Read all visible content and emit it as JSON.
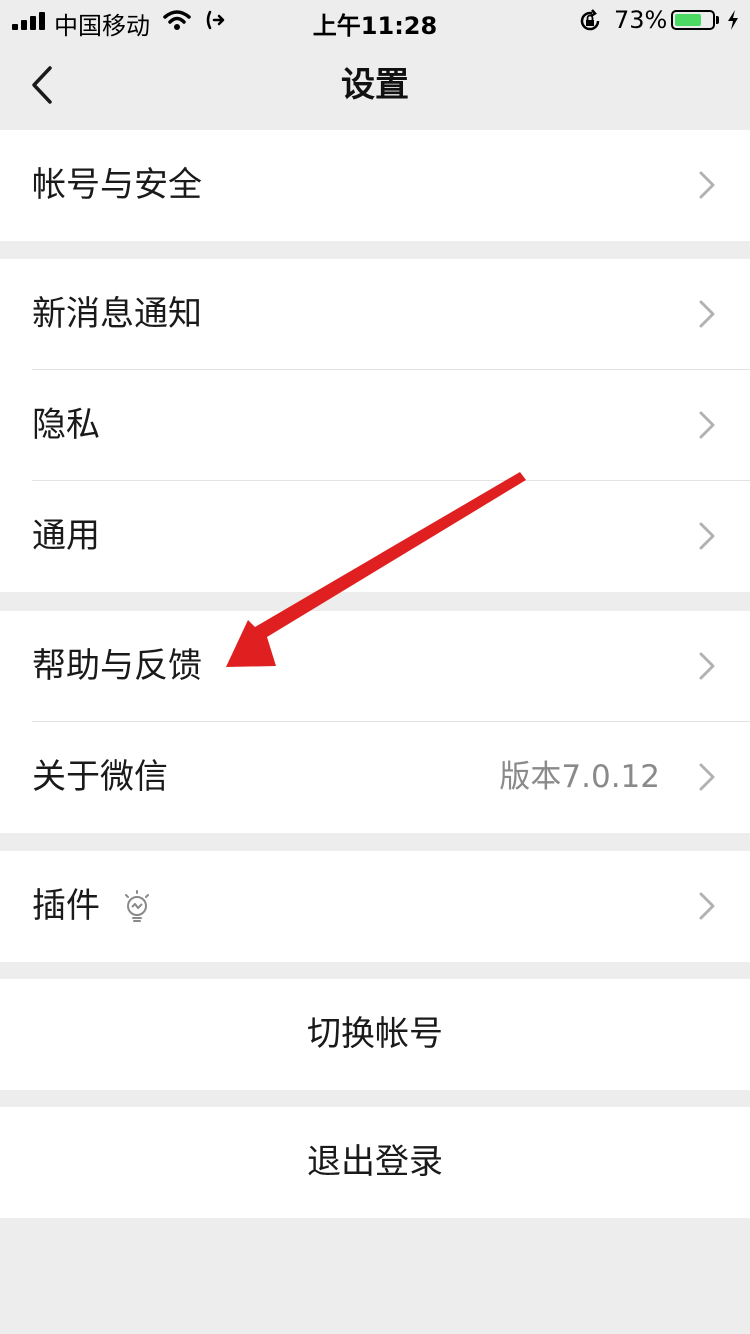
{
  "status_bar": {
    "carrier": "中国移动",
    "time": "上午11:28",
    "battery_percent": "73%",
    "battery_level": 0.73,
    "icons": [
      "signal-icon",
      "wifi-icon",
      "call-forward-icon",
      "rotation-lock-icon",
      "battery-icon",
      "charging-icon"
    ]
  },
  "nav": {
    "title": "设置",
    "back_icon": "chevron-left-icon"
  },
  "settings": {
    "account_security": "帐号与安全",
    "notifications": "新消息通知",
    "privacy": "隐私",
    "general": "通用",
    "help_feedback": "帮助与反馈",
    "about": "关于微信",
    "about_version": "版本7.0.12",
    "plugins": "插件"
  },
  "actions": {
    "switch_account": "切换帐号",
    "logout": "退出登录"
  },
  "colors": {
    "background": "#ededed",
    "battery": "#4cd964",
    "annotation_arrow": "#e02020"
  }
}
